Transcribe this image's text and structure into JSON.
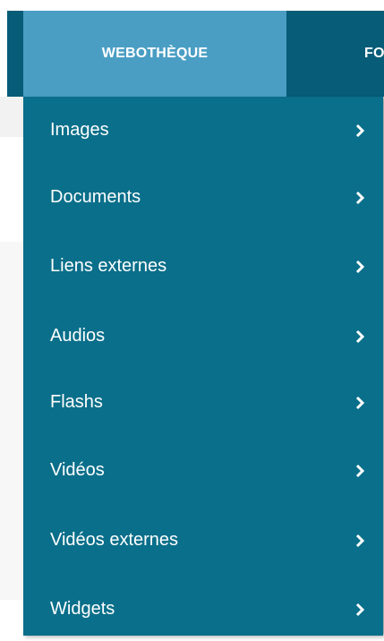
{
  "nav": {
    "active_tab": "WEBOTHÈQUE",
    "next_tab_partial": "FOR"
  },
  "menu": {
    "items": [
      {
        "label": "Images"
      },
      {
        "label": "Documents"
      },
      {
        "label": "Liens externes"
      },
      {
        "label": "Audios"
      },
      {
        "label": "Flashs"
      },
      {
        "label": "Vidéos"
      },
      {
        "label": "Vidéos externes"
      },
      {
        "label": "Widgets"
      }
    ]
  },
  "colors": {
    "nav_background": "#075c77",
    "active_tab_background": "#4a9ec4",
    "menu_background": "#0a6f8a",
    "text": "#ffffff"
  },
  "icons": {
    "menu_item_arrow": "chevron-right-icon"
  }
}
